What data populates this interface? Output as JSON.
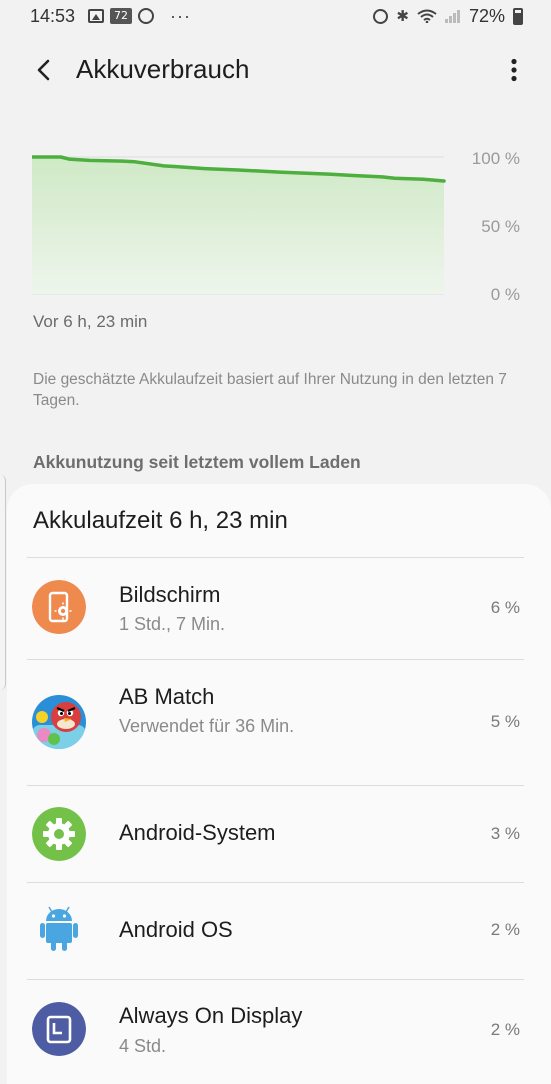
{
  "status_bar": {
    "time": "14:53",
    "badge": "72",
    "more": "···",
    "bluetooth": "✱",
    "battery_percent": "72%"
  },
  "appbar": {
    "title": "Akkuverbrauch"
  },
  "chart_data": {
    "type": "area",
    "title": "",
    "xlabel": "Vor 6 h, 23 min",
    "ylabel": "",
    "ylim": [
      0,
      100
    ],
    "y_ticks": [
      "100 %",
      "50 %",
      "0 %"
    ],
    "grid": true,
    "color": "#4caf3e",
    "x": [
      0,
      0.07,
      0.09,
      0.14,
      0.22,
      0.25,
      0.32,
      0.35,
      0.42,
      0.5,
      0.55,
      0.6,
      0.72,
      0.78,
      0.85,
      0.88,
      0.95,
      1.0
    ],
    "y": [
      100,
      100,
      98.5,
      97.5,
      97,
      96.5,
      93.5,
      93,
      91.5,
      90.5,
      89.8,
      89,
      87.5,
      86.5,
      85.5,
      84.5,
      83.8,
      82.5
    ]
  },
  "chart": {
    "caption": "Vor 6 h, 23 min"
  },
  "note": "Die geschätzte Akkulaufzeit basiert auf Ihrer Nutzung in den letzten 7 Tagen.",
  "section_header": "Akkunutzung seit letztem vollem Laden",
  "card": {
    "title": "Akkulaufzeit 6 h, 23 min",
    "items": [
      {
        "name": "Bildschirm",
        "sub": "1 Std., 7 Min.",
        "percent": "6 %",
        "icon": "screen-icon",
        "icon_color": "#ef8a4f"
      },
      {
        "name": "AB Match",
        "sub": "Verwendet für 36 Min.",
        "percent": "5 %",
        "icon": "angry-birds-app-icon",
        "icon_color": "#d84040"
      },
      {
        "name": "Android-System",
        "sub": "",
        "percent": "3 %",
        "icon": "gear-icon",
        "icon_color": "#74c14a"
      },
      {
        "name": "Android OS",
        "sub": "",
        "percent": "2 %",
        "icon": "android-robot-icon",
        "icon_color": "#4aa6e0"
      },
      {
        "name": "Always On Display",
        "sub": "4 Std.",
        "percent": "2 %",
        "icon": "always-on-display-icon",
        "icon_color": "#4e5ca3"
      }
    ]
  }
}
